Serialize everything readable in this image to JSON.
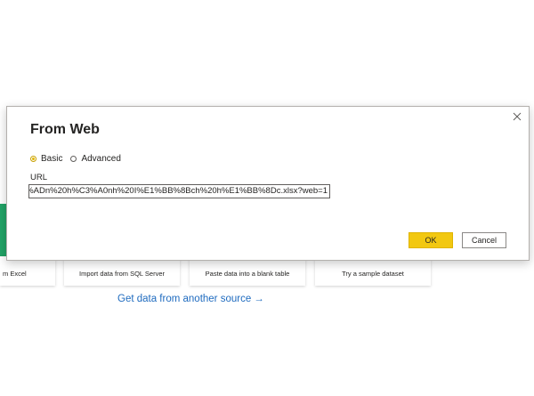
{
  "background": {
    "tiles": [
      {
        "label": "m Excel"
      },
      {
        "label": "Import data from SQL Server"
      },
      {
        "label": "Paste data into a blank table"
      },
      {
        "label": "Try a sample dataset"
      }
    ],
    "get_data_link": "Get data from another source",
    "get_data_arrow": "→"
  },
  "dialog": {
    "title": "From Web",
    "radio_basic": "Basic",
    "radio_advanced": "Advanced",
    "selected_mode": "Basic",
    "url_label": "URL",
    "url_value": "%ADn%20h%C3%A0nh%20I%E1%BB%8Bch%20h%E1%BB%8Dc.xlsx?web=1",
    "ok_label": "OK",
    "cancel_label": "Cancel",
    "close_icon": "close-icon"
  },
  "colors": {
    "accent_yellow": "#f2c811",
    "link_blue": "#1f6bbf",
    "excel_green": "#21a366"
  }
}
